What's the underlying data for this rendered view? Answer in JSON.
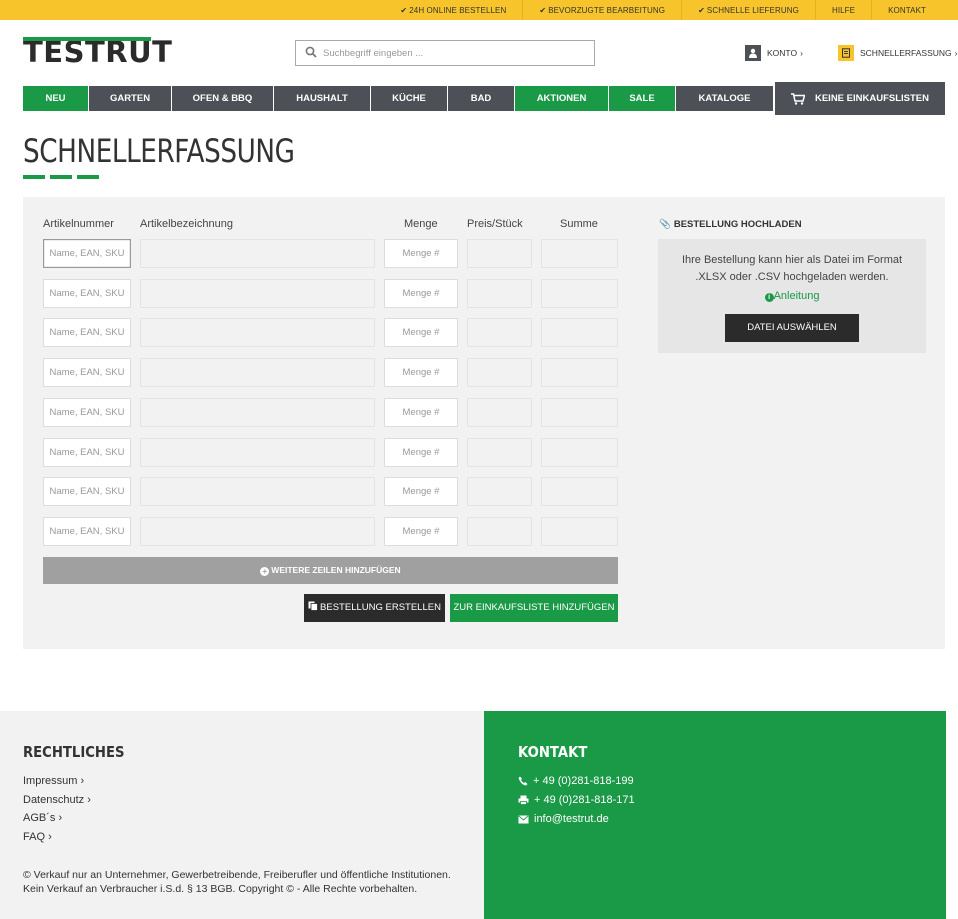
{
  "topbar": {
    "links": [
      "24H ONLINE BESTELLEN",
      "BEVORZUGTE BEARBEITUNG",
      "SCHNELLE LIEFERUNG",
      "HILFE",
      "KONTAKT"
    ]
  },
  "header": {
    "logo_text": "TESTRUT",
    "search_placeholder": "Suchbegriff eingeben ...",
    "account_label": "KONTO",
    "quickorder_label": "SCHNELLERFASSUNG"
  },
  "nav": {
    "items": [
      "NEU",
      "GARTEN",
      "OFEN & BBQ",
      "HAUSHALT",
      "KÜCHE",
      "BAD",
      "AKTIONEN",
      "SALE",
      "KATALOGE"
    ],
    "cart_label": "KEINE EINKAUFSLISTEN"
  },
  "page": {
    "title": "SCHNELLERFASSUNG"
  },
  "form": {
    "columns": {
      "article_number": "Artikelnummer",
      "description": "Artikelbezeichnung",
      "quantity": "Menge",
      "price": "Preis/Stück",
      "sum": "Summe"
    },
    "article_placeholder": "Name, EAN, SKU",
    "quantity_placeholder": "Menge #",
    "rows": 8,
    "add_rows_label": "WEITERE ZEILEN HINZUFÜGEN",
    "create_order_label": "BESTELLUNG ERSTELLEN",
    "add_to_list_label": "ZUR EINKAUFSLISTE HINZUFÜGEN"
  },
  "upload": {
    "heading": "BESTELLUNG HOCHLADEN",
    "text": "Ihre Bestellung kann hier als Datei im Format .XLSX oder .CSV hochgeladen werden.",
    "link": "Anleitung",
    "button": "DATEI AUSWÄHLEN"
  },
  "footer": {
    "legal_heading": "RECHTLICHES",
    "legal_links": [
      "Impressum",
      "Datenschutz",
      "AGB´s",
      "FAQ"
    ],
    "copyright": "© Verkauf nur an Unternehmer, Gewerbetreibende, Freiberufler und öffentliche Institutionen. Kein Verkauf an Verbraucher i.S.d. § 13 BGB. Copyright © - Alle Rechte vorbehalten.",
    "contact_heading": "KONTAKT",
    "phone": "+ 49 (0)281-818-199",
    "fax": "+ 49 (0)281-818-171",
    "email": "info@testrut.de"
  },
  "colors": {
    "accent_yellow": "#f7c52b",
    "brand_green": "#1a9a47",
    "nav_dark": "#4d5057"
  }
}
